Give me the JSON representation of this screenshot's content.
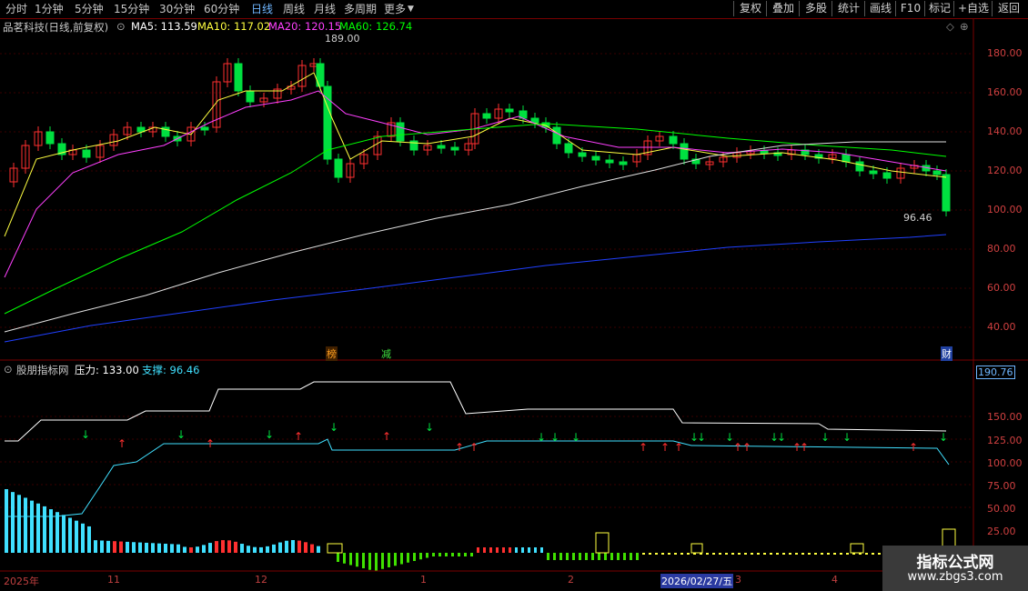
{
  "topbar": {
    "periods": [
      "分时",
      "1分钟",
      "5分钟",
      "15分钟",
      "30分钟",
      "60分钟",
      "日线",
      "周线",
      "月线",
      "多周期",
      "更多"
    ],
    "active_period": "日线",
    "right_buttons": [
      "复权",
      "叠加",
      "多股",
      "统计",
      "画线",
      "F10",
      "标记",
      "+自选",
      "返回"
    ]
  },
  "header": {
    "stock": "品茗科技(日线,前复权)",
    "ma5": "MA5: 113.59",
    "ma10": "MA10: 117.02",
    "ma20": "MA20: 120.15",
    "ma60": "MA60: 126.74"
  },
  "price_axis": [
    "180.00",
    "160.00",
    "140.00",
    "120.00",
    "100.00",
    "80.00",
    "60.00",
    "40.00"
  ],
  "annotations": {
    "high": "189.00",
    "low": "96.46",
    "tag1": "榜",
    "tag2": "减",
    "tag3": "财"
  },
  "indicator": {
    "name": "股朋指标网",
    "pressure": "压力: 133.00",
    "support": "支撑: 96.46",
    "axis_top": "190.76",
    "axis": [
      "150.00",
      "125.00",
      "100.00",
      "75.00",
      "50.00",
      "25.00"
    ]
  },
  "dates": [
    "2025年",
    "11",
    "12",
    "1",
    "2",
    "2026/02/27/五",
    "3",
    "4"
  ],
  "colors": {
    "up": "#ff3030",
    "down": "#00e040",
    "ma5": "#ffffff",
    "ma10": "#ffff40",
    "ma20": "#ff40ff",
    "ma60": "#00ff00",
    "ma_long": "#ffffff",
    "ma_blue": "#2040ff",
    "accent": "#6fb6ff"
  },
  "watermark": {
    "title": "指标公式网",
    "url": "www.zbgs3.com"
  }
}
